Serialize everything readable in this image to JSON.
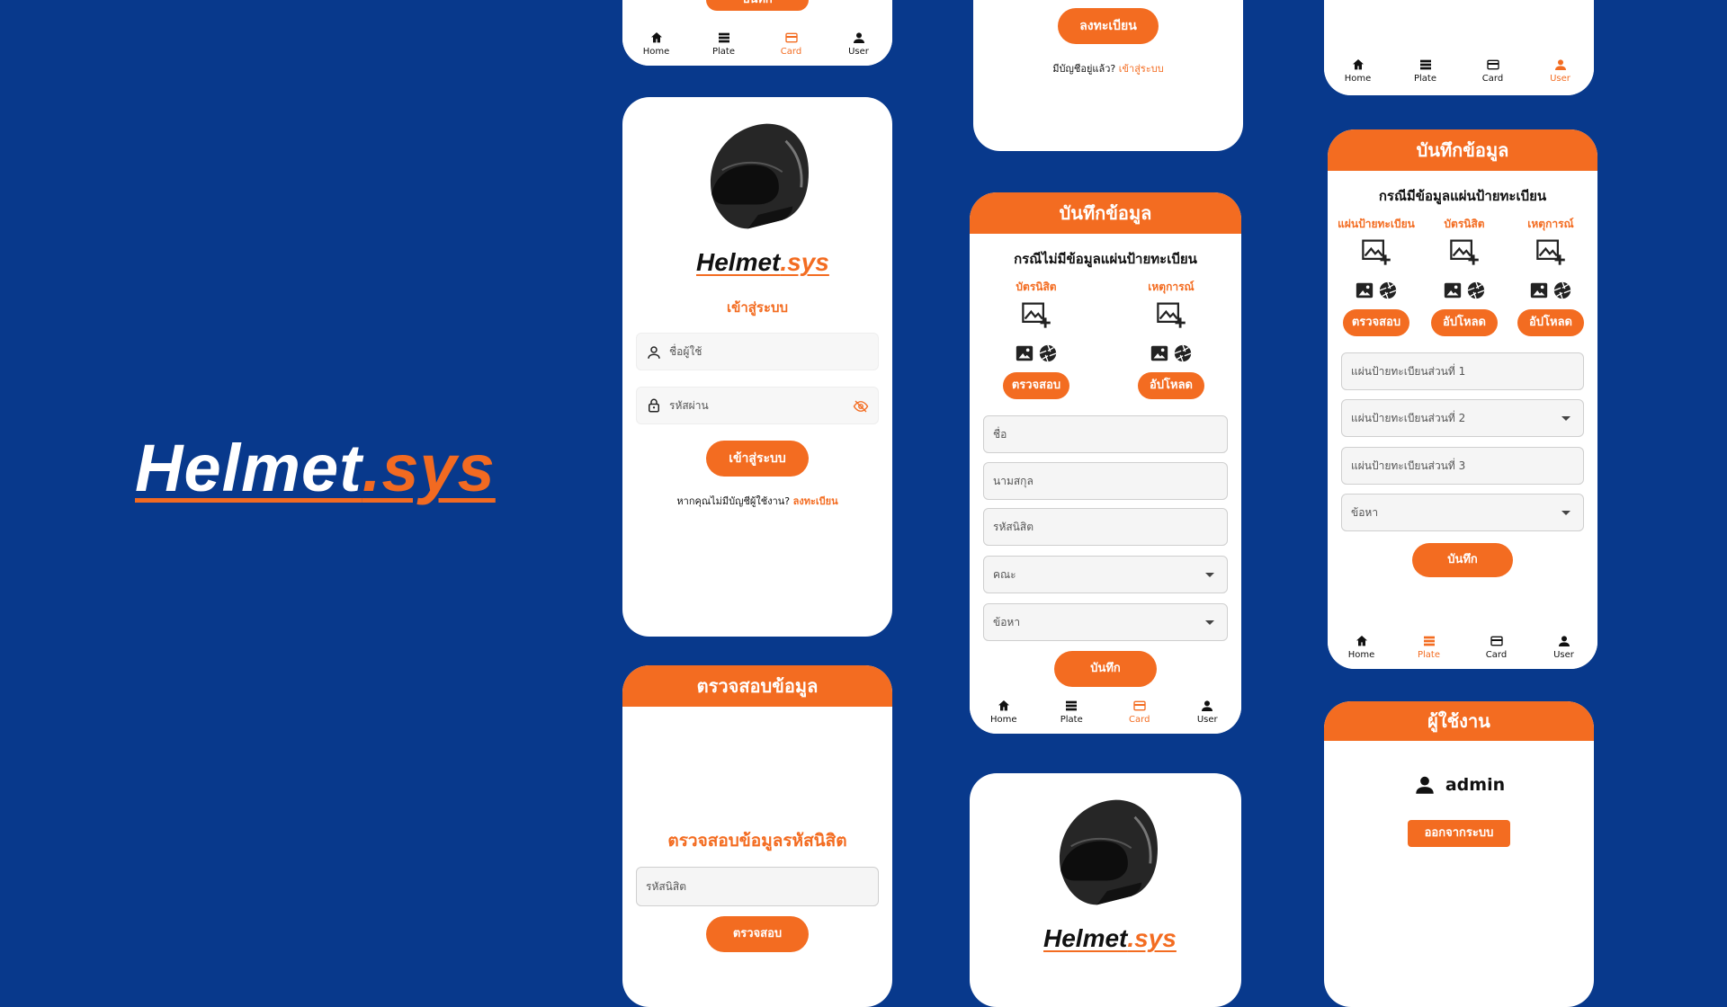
{
  "brand": {
    "main": "Helmet",
    "suffix": ".sys"
  },
  "colors": {
    "background": "#08398c",
    "accent": "#f36c21",
    "card": "#ffffff"
  },
  "nav_items": [
    "Home",
    "Plate",
    "Card",
    "User"
  ],
  "cards": {
    "top_left": {
      "button": "บันทึก",
      "active_nav": "Card"
    },
    "top_mid": {
      "button": "ลงทะเบียน",
      "prompt": "มีบัญชีอยู่แล้ว?",
      "link": "เข้าสู่ระบบ"
    },
    "top_right": {
      "active_nav": "User"
    },
    "login": {
      "logo_main": "Helmet",
      "logo_suffix": ".sys",
      "title": "เข้าสู่ระบบ",
      "username_placeholder": "ชื่อผู้ใช้",
      "password_placeholder": "รหัสผ่าน",
      "button": "เข้าสู่ระบบ",
      "prompt": "หากคุณไม่มีบัญชีผู้ใช้งาน?",
      "link": "ลงทะเบียน"
    },
    "verify": {
      "header": "ตรวจสอบข้อมูล",
      "title": "ตรวจสอบข้อมูลรหัสนิสิต",
      "id_placeholder": "รหัสนิสิต",
      "button": "ตรวจสอบ"
    },
    "record_noplate": {
      "header": "บันทึกข้อมูล",
      "subtitle": "กรณีไม่มีข้อมูลแผ่นป้ายทะเบียน",
      "col1_label": "บัตรนิสิต",
      "col1_button": "ตรวจสอบ",
      "col2_label": "เหตุการณ์",
      "col2_button": "อัปโหลด",
      "fields": [
        "ชื่อ",
        "นามสกุล",
        "รหัสนิสิต"
      ],
      "dropdowns": [
        "คณะ",
        "ข้อหา"
      ],
      "save_button": "บันทึก",
      "active_nav": "Card"
    },
    "logo_bottom": {
      "logo_main": "Helmet",
      "logo_suffix": ".sys"
    },
    "record_plate": {
      "header": "บันทึกข้อมูล",
      "subtitle": "กรณีมีข้อมูลแผ่นป้ายทะเบียน",
      "col1_label": "แผ่นป้ายทะเบียน",
      "col1_button": "ตรวจสอบ",
      "col2_label": "บัตรนิสิต",
      "col2_button": "อัปโหลด",
      "col3_label": "เหตุการณ์",
      "col3_button": "อัปโหลด",
      "part1": "แผ่นป้ายทะเบียนส่วนที่ 1",
      "part2": "แผ่นป้ายทะเบียนส่วนที่ 2",
      "part3": "แผ่นป้ายทะเบียนส่วนที่ 3",
      "charge": "ข้อหา",
      "save_button": "บันทึก",
      "active_nav": "Plate"
    },
    "user": {
      "header": "ผู้ใช้งาน",
      "username": "admin",
      "logout_button": "ออกจากระบบ"
    }
  }
}
